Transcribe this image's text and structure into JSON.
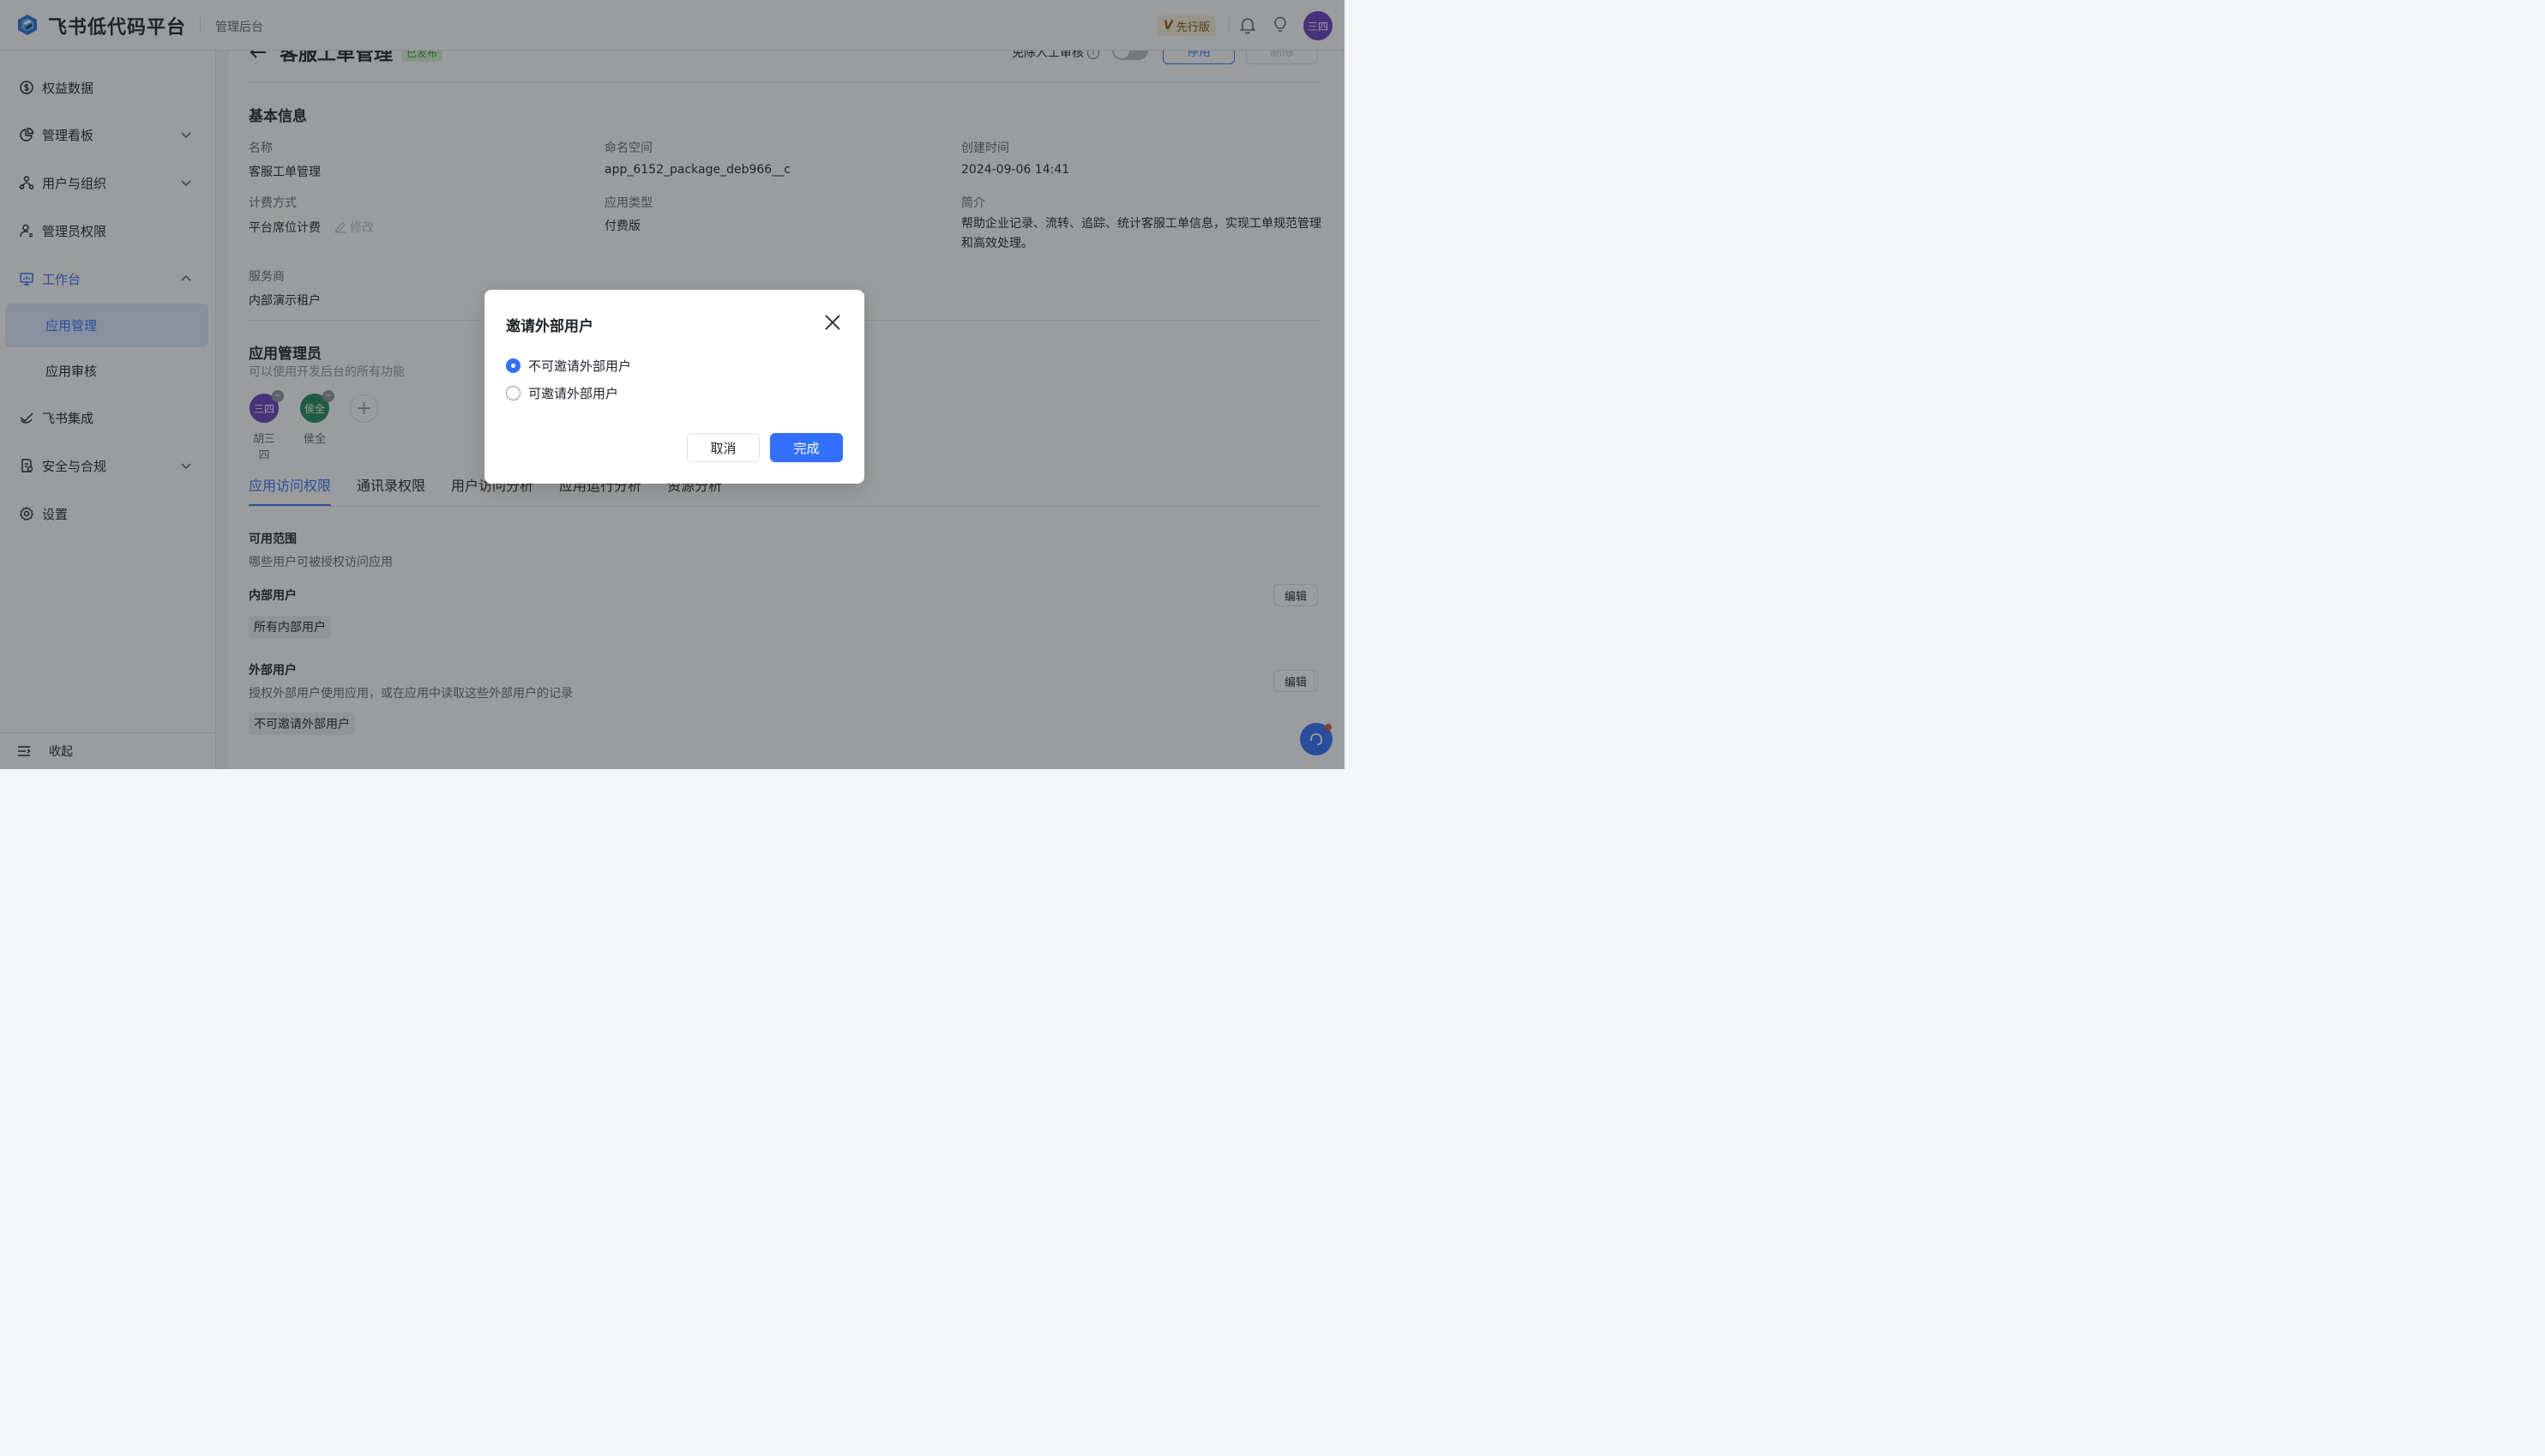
{
  "header": {
    "brand": "飞书低代码平台",
    "subtitle": "管理后台",
    "version_badge_v": "V",
    "version_badge": "先行版",
    "avatar_text": "三四",
    "avatar_color": "#6b3fc2"
  },
  "sidebar": {
    "items": [
      {
        "label": "权益数据",
        "icon": "dollar-circle-icon"
      },
      {
        "label": "管理看板",
        "icon": "pie-chart-icon"
      },
      {
        "label": "用户与组织",
        "icon": "org-icon"
      },
      {
        "label": "管理员权限",
        "icon": "admin-user-icon"
      },
      {
        "label": "工作台",
        "icon": "workbench-icon"
      },
      {
        "label": "飞书集成",
        "icon": "integration-icon"
      },
      {
        "label": "安全与合规",
        "icon": "security-doc-icon"
      },
      {
        "label": "设置",
        "icon": "gear-icon"
      }
    ],
    "sub_items": [
      {
        "label": "应用管理"
      },
      {
        "label": "应用审核"
      }
    ],
    "collapse_label": "收起"
  },
  "main": {
    "app_title": "客服工单管理",
    "status_tag": "已发布",
    "review_label": "免除人工审核",
    "stop_button": "停用",
    "delete_button": "删除",
    "basic_info_title": "基本信息",
    "fields": {
      "name_label": "名称",
      "name_value": "客服工单管理",
      "namespace_label": "命名空间",
      "namespace_value": "app_6152_package_deb966__c",
      "created_label": "创建时间",
      "created_value": "2024-09-06 14:41",
      "billing_label": "计费方式",
      "billing_value": "平台席位计费",
      "billing_edit": "修改",
      "type_label": "应用类型",
      "type_value": "付费版",
      "intro_label": "简介",
      "intro_value": "帮助企业记录、流转、追踪、统计客服工单信息，实现工单规范管理和高效处理。",
      "provider_label": "服务商",
      "provider_value": "内部演示租户"
    },
    "admins_title": "应用管理员",
    "admins_subtitle": "可以使用开发后台的所有功能",
    "admins": [
      {
        "avatar": "三四",
        "name": "胡三四",
        "color": "#6b3fc2"
      },
      {
        "avatar": "侯全",
        "name": "侯全",
        "color": "#1f8a5a"
      }
    ],
    "tabs": [
      "应用访问权限",
      "通讯录权限",
      "用户访问分析",
      "应用运行分析",
      "资源分析"
    ],
    "scope_title": "可用范围",
    "scope_desc": "哪些用户可被授权访问应用",
    "internal_title": "内部用户",
    "internal_tag": "所有内部用户",
    "external_title": "外部用户",
    "external_desc": "授权外部用户使用应用，或在应用中读取这些外部用户的记录",
    "external_tag": "不可邀请外部用户",
    "edit_label": "编辑"
  },
  "dialog": {
    "title": "邀请外部用户",
    "options": [
      {
        "label": "不可邀请外部用户",
        "checked": true
      },
      {
        "label": "可邀请外部用户",
        "checked": false
      }
    ],
    "cancel": "取消",
    "confirm": "完成"
  },
  "colors": {
    "accent": "#3370ff",
    "published": "#2ea121"
  }
}
